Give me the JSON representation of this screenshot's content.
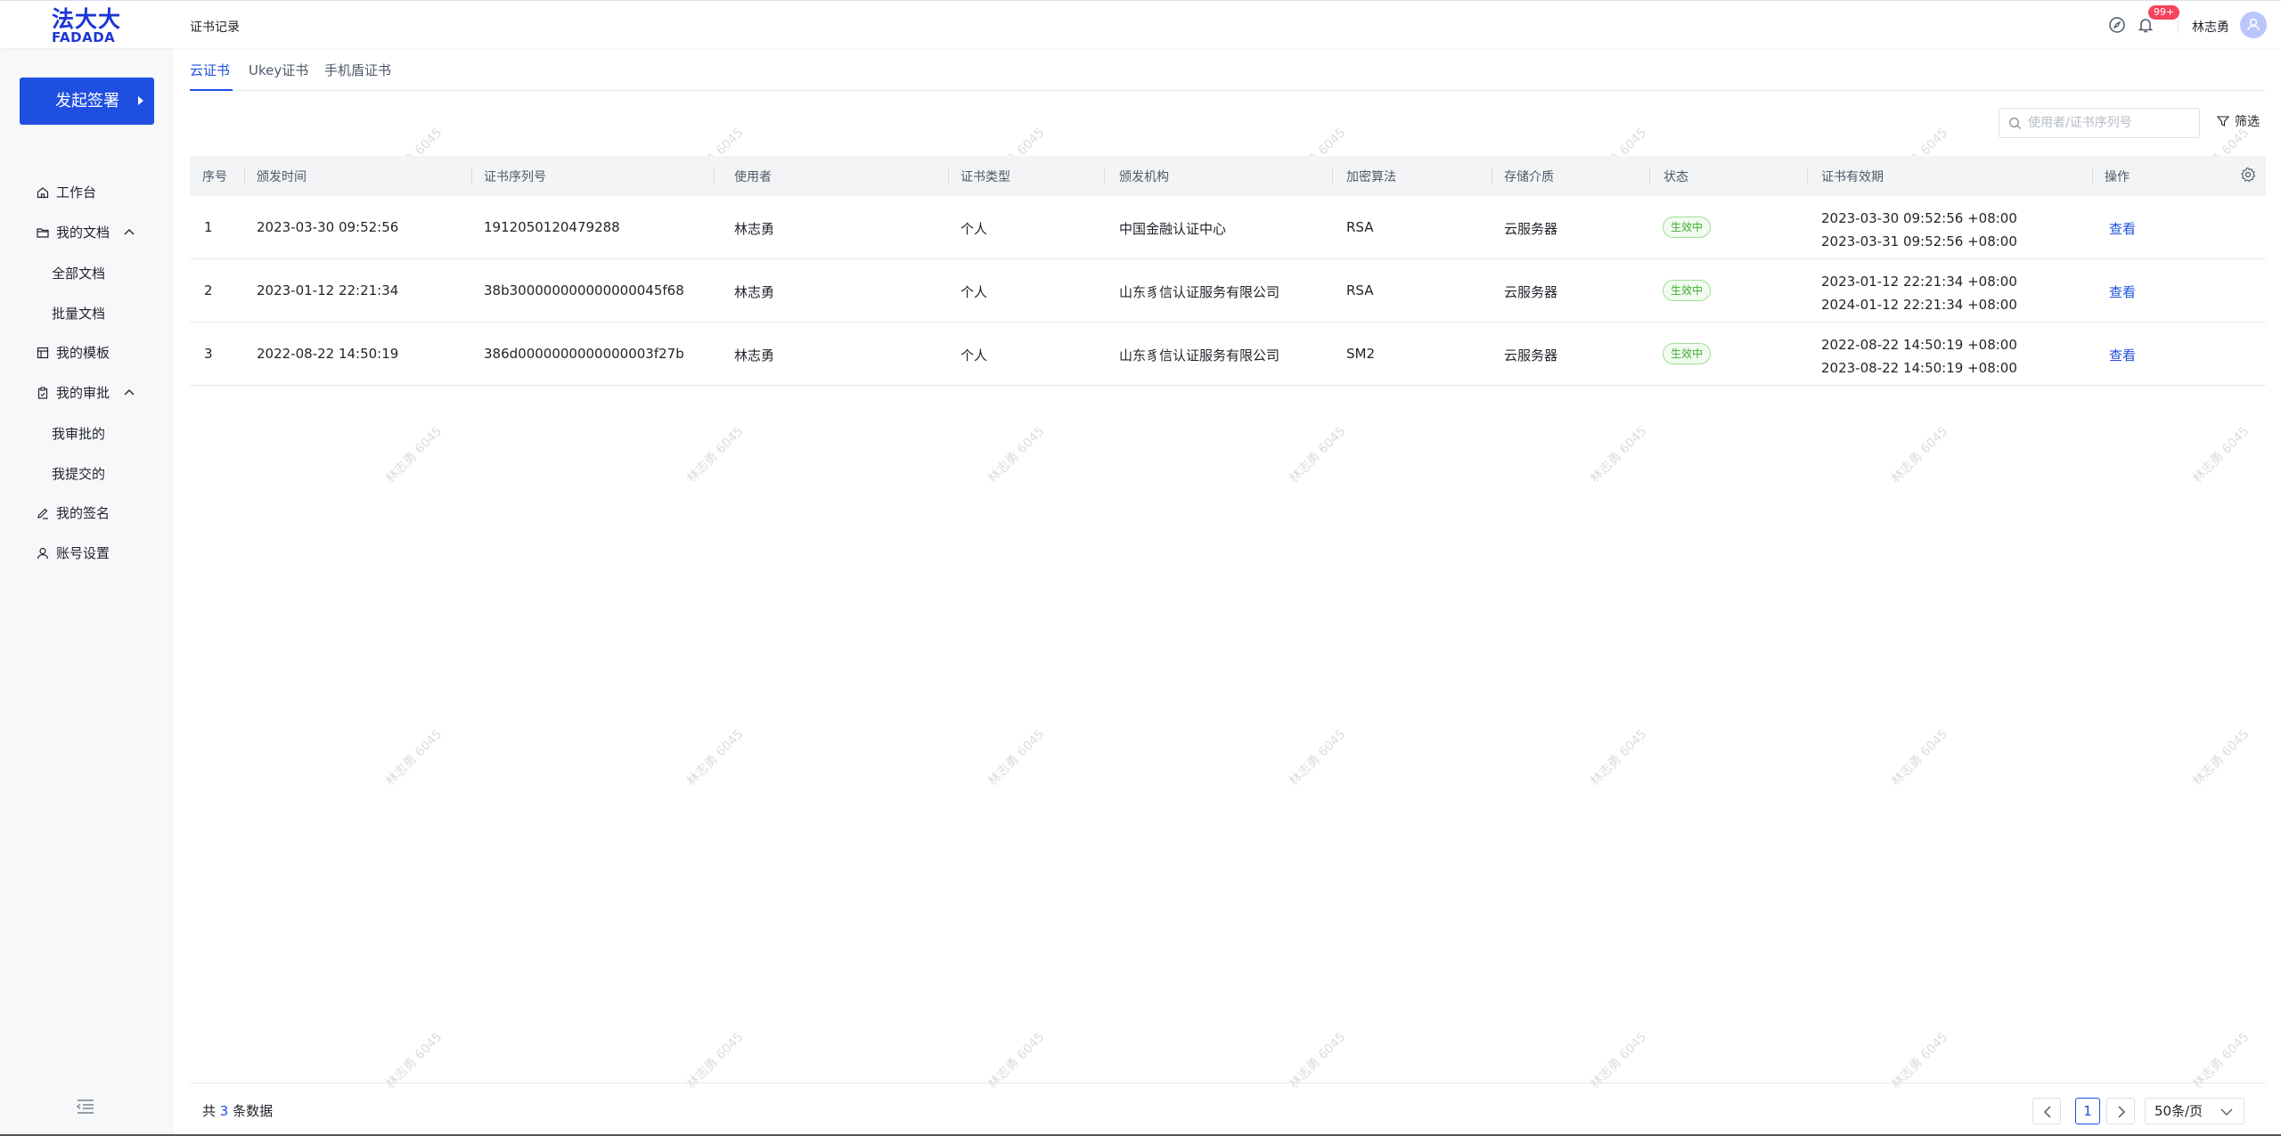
{
  "header": {
    "logo_top": "法大大",
    "logo_bottom": "FADADA",
    "page_title": "证书记录",
    "notification_badge": "99+",
    "username": "林志勇"
  },
  "sidebar": {
    "start_button": "发起签署",
    "items": [
      {
        "label": "工作台",
        "icon": "home-icon"
      },
      {
        "label": "我的文档",
        "icon": "folder-icon",
        "expanded": true
      },
      {
        "label": "全部文档"
      },
      {
        "label": "批量文档"
      },
      {
        "label": "我的模板",
        "icon": "template-icon"
      },
      {
        "label": "我的审批",
        "icon": "clipboard-icon",
        "expanded": true
      },
      {
        "label": "我审批的"
      },
      {
        "label": "我提交的"
      },
      {
        "label": "我的签名",
        "icon": "pen-icon"
      },
      {
        "label": "账号设置",
        "icon": "user-icon"
      }
    ]
  },
  "tabs": [
    {
      "label": "云证书",
      "active": true
    },
    {
      "label": "Ukey证书",
      "active": false
    },
    {
      "label": "手机盾证书",
      "active": false
    }
  ],
  "search": {
    "placeholder": "使用者/证书序列号",
    "value": ""
  },
  "filter_label": "筛选",
  "table": {
    "columns": [
      "序号",
      "颁发时间",
      "证书序列号",
      "使用者",
      "证书类型",
      "颁发机构",
      "加密算法",
      "存储介质",
      "状态",
      "证书有效期",
      "操作"
    ],
    "rows": [
      {
        "index": "1",
        "issued": "2023-03-30 09:52:56",
        "serial": "1912050120479288",
        "user": "林志勇",
        "type": "个人",
        "issuer": "中国金融认证中心",
        "algo": "RSA",
        "storage": "云服务器",
        "status": "生效中",
        "valid_from": "2023-03-30 09:52:56 +08:00",
        "valid_to": "2023-03-31 09:52:56 +08:00",
        "action": "查看"
      },
      {
        "index": "2",
        "issued": "2023-01-12 22:21:34",
        "serial": "38b300000000000000045f68",
        "user": "林志勇",
        "type": "个人",
        "issuer": "山东豸信认证服务有限公司",
        "algo": "RSA",
        "storage": "云服务器",
        "status": "生效中",
        "valid_from": "2023-01-12 22:21:34 +08:00",
        "valid_to": "2024-01-12 22:21:34 +08:00",
        "action": "查看"
      },
      {
        "index": "3",
        "issued": "2022-08-22 14:50:19",
        "serial": "386d0000000000000003f27b",
        "user": "林志勇",
        "type": "个人",
        "issuer": "山东豸信认证服务有限公司",
        "algo": "SM2",
        "storage": "云服务器",
        "status": "生效中",
        "valid_from": "2022-08-22 14:50:19 +08:00",
        "valid_to": "2023-08-22 14:50:19 +08:00",
        "action": "查看"
      }
    ]
  },
  "footer": {
    "total_prefix": "共",
    "total_count": "3",
    "total_suffix": "条数据",
    "current_page": "1",
    "page_size": "50条/页"
  },
  "watermark": "林志勇 6045",
  "colors": {
    "brand": "#1f4fe0",
    "status_green": "#3fad34",
    "badge_red": "#f5445c"
  }
}
